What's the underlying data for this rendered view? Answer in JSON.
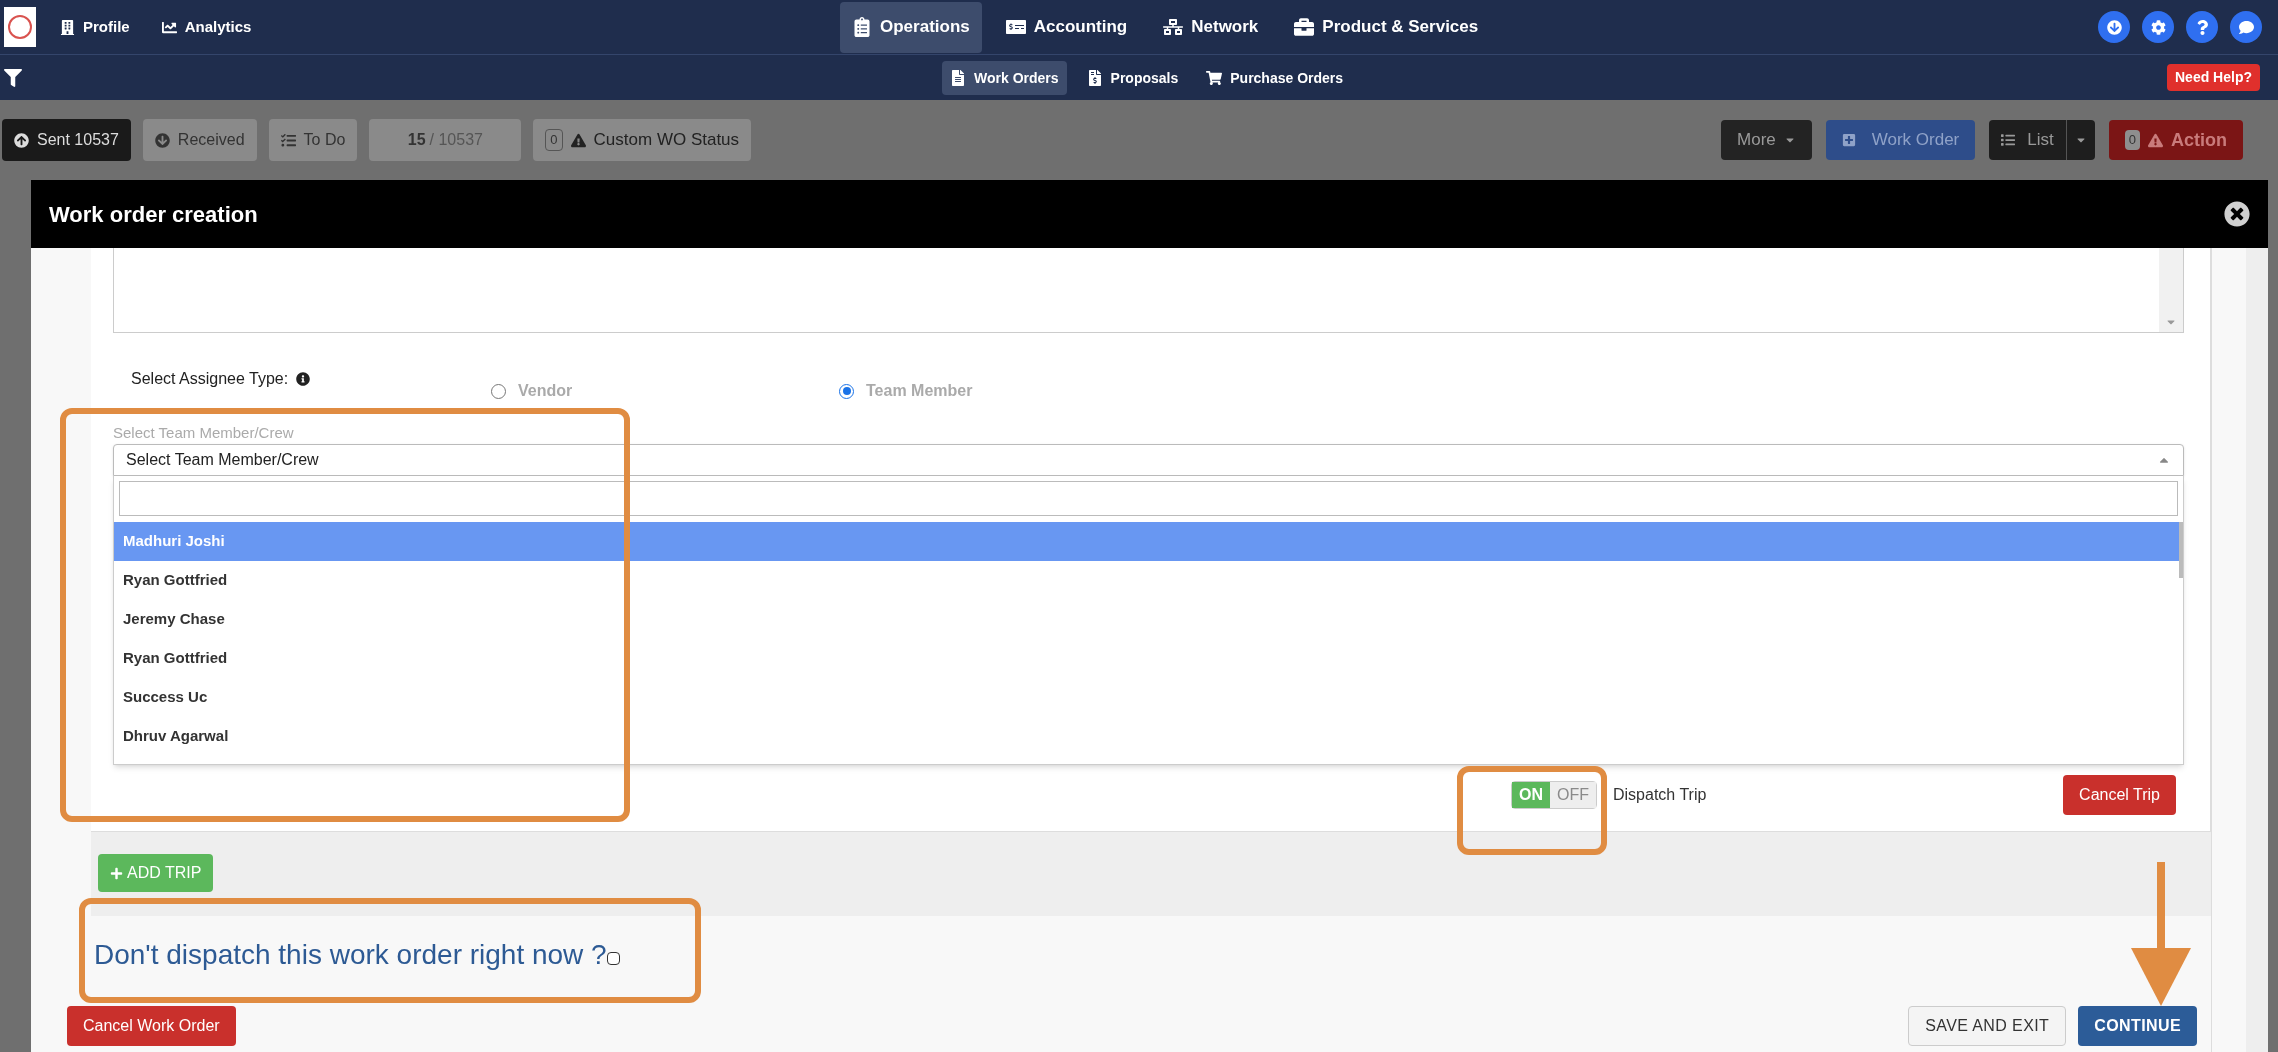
{
  "top_nav": {
    "left": [
      {
        "kind": "profile",
        "label": "Profile"
      },
      {
        "kind": "analytics",
        "label": "Analytics"
      }
    ],
    "center": [
      {
        "kind": "operations",
        "label": "Operations",
        "selected": true
      },
      {
        "kind": "accounting",
        "label": "Accounting",
        "selected": false
      },
      {
        "kind": "network",
        "label": "Network",
        "selected": false
      },
      {
        "kind": "products",
        "label": "Product & Services",
        "selected": false
      }
    ]
  },
  "sub_nav": {
    "items": [
      {
        "kind": "work_orders",
        "label": "Work Orders",
        "selected": true
      },
      {
        "kind": "proposals",
        "label": "Proposals",
        "selected": false
      },
      {
        "kind": "purchase",
        "label": "Purchase Orders",
        "selected": false
      }
    ],
    "help": "Need Help?"
  },
  "toolbar": {
    "sent": "Sent 10537",
    "received": "Received",
    "todo": "To Do",
    "page": "15",
    "separator": "/",
    "total": "10537",
    "status_count": "0",
    "status": "Custom WO Status",
    "more": "More",
    "work_order": "Work Order",
    "list": "List",
    "action_count": "0",
    "action": "Action"
  },
  "modal": {
    "title": "Work order creation",
    "assignee_label": "Select Assignee Type:",
    "assignee_types": [
      {
        "label": "Vendor",
        "selected": false
      },
      {
        "label": "Team Member",
        "selected": true
      }
    ],
    "member_label": "Select Team Member/Crew",
    "member_select": {
      "value": "Select Team Member/Crew",
      "expanded": true,
      "options": [
        {
          "label": "Madhuri Joshi",
          "selected": true
        },
        {
          "label": "Ryan Gottfried",
          "selected": false
        },
        {
          "label": "Jeremy Chase",
          "selected": false
        },
        {
          "label": "Ryan Gottfried",
          "selected": false
        },
        {
          "label": "Success Uc",
          "selected": false
        },
        {
          "label": "Dhruv Agarwal",
          "selected": false
        }
      ]
    },
    "dispatch": {
      "on_label": "ON",
      "off_label": "OFF",
      "on": true,
      "label": "Dispatch Trip"
    },
    "cancel_trip": "Cancel Trip",
    "add_trip": "ADD TRIP",
    "dont_dispatch": {
      "label": "Don't dispatch this work order right now ?",
      "checked": false
    },
    "cancel_work_order": "Cancel Work Order",
    "save_exit": "SAVE AND EXIT",
    "continue": "CONTINUE"
  }
}
